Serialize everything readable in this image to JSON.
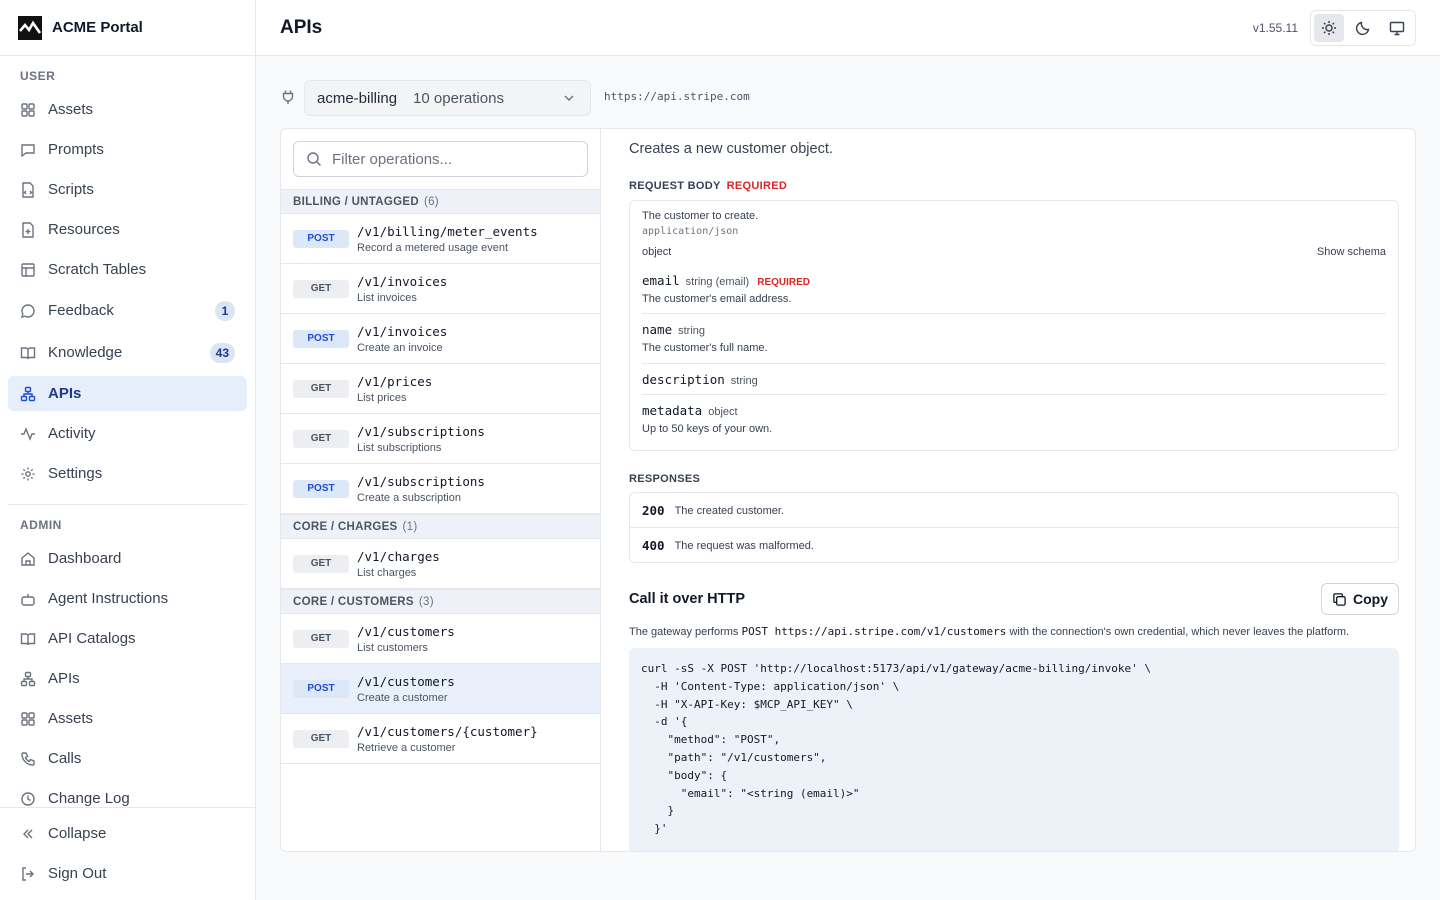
{
  "app": {
    "name": "ACME Portal",
    "version": "v1.55.11"
  },
  "header": {
    "title": "APIs"
  },
  "sidebar": {
    "user_label": "USER",
    "admin_label": "ADMIN",
    "user_items": [
      {
        "label": "Assets",
        "icon": "grid-icon"
      },
      {
        "label": "Prompts",
        "icon": "message-square-icon"
      },
      {
        "label": "Scripts",
        "icon": "file-code-icon"
      },
      {
        "label": "Resources",
        "icon": "file-plus-icon"
      },
      {
        "label": "Scratch Tables",
        "icon": "table-icon"
      },
      {
        "label": "Feedback",
        "icon": "message-circle-icon",
        "badge": "1"
      },
      {
        "label": "Knowledge",
        "icon": "book-open-icon",
        "badge": "43"
      },
      {
        "label": "APIs",
        "icon": "network-icon",
        "active": true
      },
      {
        "label": "Activity",
        "icon": "activity-icon"
      },
      {
        "label": "Settings",
        "icon": "gear-icon"
      }
    ],
    "admin_items": [
      {
        "label": "Dashboard",
        "icon": "home-icon"
      },
      {
        "label": "Agent Instructions",
        "icon": "bot-icon"
      },
      {
        "label": "API Catalogs",
        "icon": "book-open-icon"
      },
      {
        "label": "APIs",
        "icon": "network-icon"
      },
      {
        "label": "Assets",
        "icon": "grid-icon"
      },
      {
        "label": "Calls",
        "icon": "phone-icon"
      },
      {
        "label": "Change Log",
        "icon": "clock-icon"
      }
    ],
    "collapse_label": "Collapse",
    "signout_label": "Sign Out"
  },
  "connection": {
    "name": "acme-billing",
    "operations": "10 operations",
    "base_url": "https://api.stripe.com"
  },
  "filter": {
    "placeholder": "Filter operations..."
  },
  "groups": [
    {
      "name": "BILLING / UNTAGGED",
      "count": "(6)"
    },
    {
      "name": "CORE / CHARGES",
      "count": "(1)"
    },
    {
      "name": "CORE / CUSTOMERS",
      "count": "(3)"
    }
  ],
  "operations": [
    {
      "method": "POST",
      "path": "/v1/billing/meter_events",
      "desc": "Record a metered usage event"
    },
    {
      "method": "GET",
      "path": "/v1/invoices",
      "desc": "List invoices"
    },
    {
      "method": "POST",
      "path": "/v1/invoices",
      "desc": "Create an invoice"
    },
    {
      "method": "GET",
      "path": "/v1/prices",
      "desc": "List prices"
    },
    {
      "method": "GET",
      "path": "/v1/subscriptions",
      "desc": "List subscriptions"
    },
    {
      "method": "POST",
      "path": "/v1/subscriptions",
      "desc": "Create a subscription"
    },
    {
      "method": "GET",
      "path": "/v1/charges",
      "desc": "List charges"
    },
    {
      "method": "GET",
      "path": "/v1/customers",
      "desc": "List customers"
    },
    {
      "method": "POST",
      "path": "/v1/customers",
      "desc": "Create a customer"
    },
    {
      "method": "GET",
      "path": "/v1/customers/{customer}",
      "desc": "Retrieve a customer"
    }
  ],
  "detail": {
    "summary": "Creates a new customer object.",
    "request_body_label": "REQUEST BODY",
    "required_label": "REQUIRED",
    "body_desc": "The customer to create.",
    "content_type": "application/json",
    "body_type": "object",
    "show_schema": "Show schema",
    "properties": [
      {
        "name": "email",
        "type": "string (email)",
        "required": "REQUIRED",
        "desc": "The customer's email address."
      },
      {
        "name": "name",
        "type": "string",
        "desc": "The customer's full name."
      },
      {
        "name": "description",
        "type": "string"
      },
      {
        "name": "metadata",
        "type": "object",
        "desc": "Up to 50 keys of your own."
      }
    ],
    "responses_label": "RESPONSES",
    "responses": [
      {
        "code": "200",
        "desc": "The created customer."
      },
      {
        "code": "400",
        "desc": "The request was malformed."
      }
    ],
    "call_title": "Call it over HTTP",
    "copy_label": "Copy",
    "note_prefix": "The gateway performs",
    "note_code": "POST https://api.stripe.com/v1/customers",
    "note_suffix": "with the connection's own credential, which never leaves the platform.",
    "curl": "curl -sS -X POST 'http://localhost:5173/api/v1/gateway/acme-billing/invoke' \\\n  -H 'Content-Type: application/json' \\\n  -H \"X-API-Key: $MCP_API_KEY\" \\\n  -d '{\n    \"method\": \"POST\",\n    \"path\": \"/v1/customers\",\n    \"body\": {\n      \"email\": \"<string (email)>\"\n    }\n  }'"
  }
}
